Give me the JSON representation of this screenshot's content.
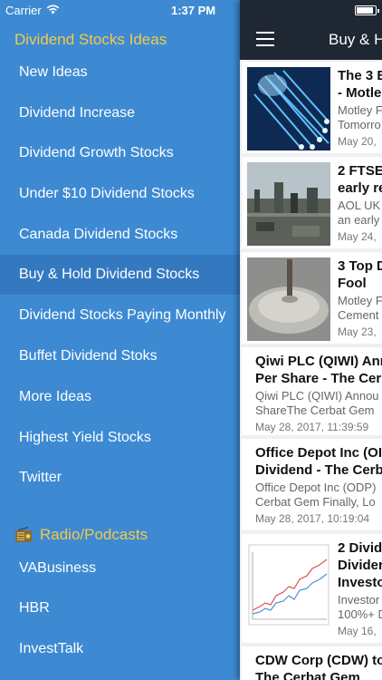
{
  "status": {
    "carrier": "Carrier",
    "time": "1:37 PM"
  },
  "drawer": {
    "title": "Dividend Stocks Ideas",
    "items": [
      {
        "label": "New Ideas"
      },
      {
        "label": "Dividend Increase"
      },
      {
        "label": "Dividend Growth Stocks"
      },
      {
        "label": "Under $10 Dividend Stocks"
      },
      {
        "label": "Canada Dividend Stocks"
      },
      {
        "label": "Buy & Hold Dividend Stocks",
        "active": true
      },
      {
        "label": "Dividend Stocks Paying Monthly"
      },
      {
        "label": "Buffet Dividend Stoks"
      },
      {
        "label": "More Ideas"
      },
      {
        "label": "Highest Yield Stocks"
      },
      {
        "label": "Twitter"
      }
    ],
    "section": {
      "label": "Radio/Podcasts",
      "icon": "radio-icon"
    },
    "section_items": [
      {
        "label": "VABusiness"
      },
      {
        "label": "HBR"
      },
      {
        "label": "InvestTalk"
      }
    ]
  },
  "main": {
    "nav_title": "Buy & H",
    "menu_icon": "hamburger-icon",
    "articles": [
      {
        "title1": "The 3 B",
        "title2": "- Motle",
        "snippet1": "Motley F",
        "snippet2": "Tomorro",
        "date": "May 20,",
        "thumb": "fiber"
      },
      {
        "title1": "2 FTSE",
        "title2": "early re",
        "snippet1": "AOL UK",
        "snippet2": "an early",
        "date": "May 24,",
        "thumb": "city"
      },
      {
        "title1": "3 Top D",
        "title2": "Fool",
        "snippet1": "Motley F",
        "snippet2": "Cement",
        "date": "May 23,",
        "thumb": "cement"
      },
      {
        "title1": "Qiwi PLC (QIWI) Anr",
        "title2": "Per Share - The Cer",
        "snippet1": "Qiwi PLC (QIWI) Annou",
        "snippet2": "ShareThe Cerbat Gem",
        "date": "May 28, 2017, 11:39:59"
      },
      {
        "title1": "Office Depot Inc (OI",
        "title2": "Dividend - The Cerb",
        "snippet1": "Office Depot Inc (ODP)",
        "snippet2": "Cerbat Gem  Finally, Lo",
        "date": "May 28, 2017, 10:19:04"
      },
      {
        "title1": "2 Divid",
        "title2": "Divider",
        "title3": "Investo",
        "snippet1": "Investor",
        "snippet2": "100%+ D",
        "date": "May 16,",
        "thumb": "chart"
      },
      {
        "title1": "CDW Corp (CDW) to",
        "title2": "The Cerbat Gem"
      }
    ]
  },
  "colors": {
    "drawer_bg": "#3d8ad3",
    "drawer_active": "#3479c0",
    "accent_yellow": "#f3c94a",
    "navbar_bg": "#1f2733",
    "feed_bg": "#efeff4"
  }
}
